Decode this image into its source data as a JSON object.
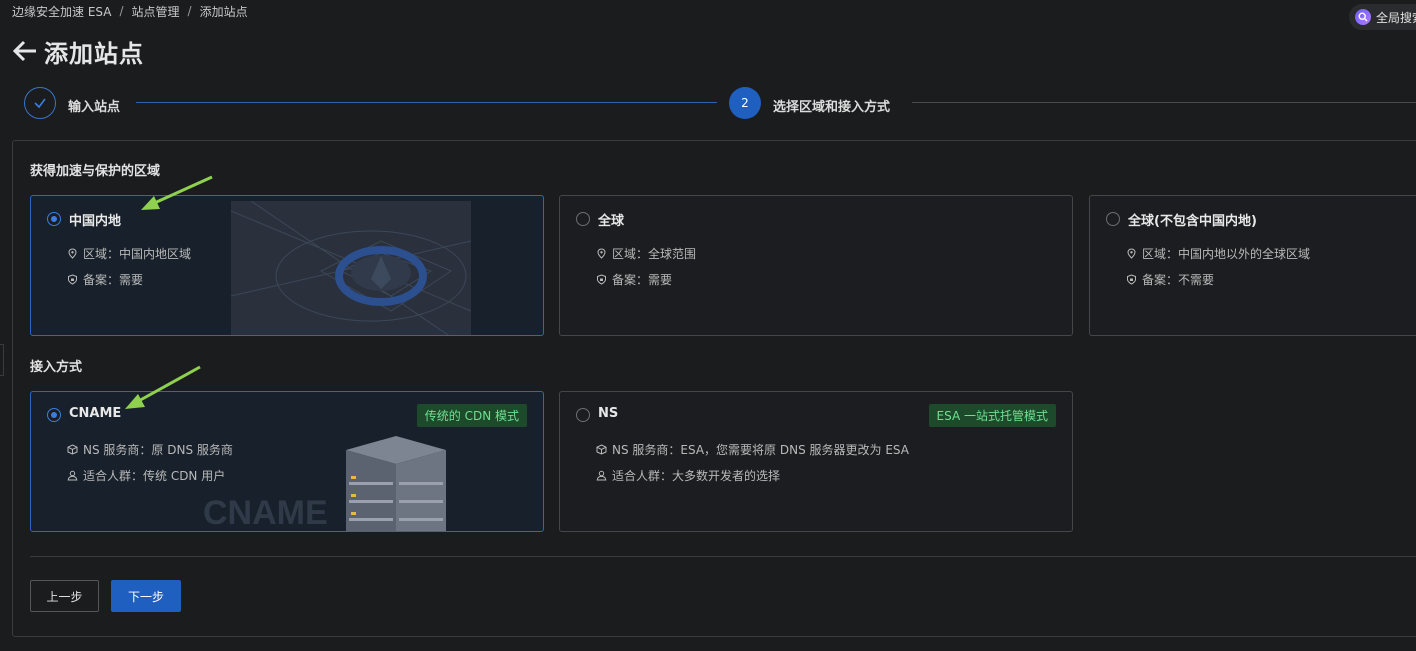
{
  "breadcrumb": [
    "边缘安全加速 ESA",
    "站点管理",
    "添加站点"
  ],
  "breadcrumb_sep": "/",
  "global_search": {
    "label": "全局搜索"
  },
  "header": {
    "title": "添加站点"
  },
  "steps": [
    {
      "label": "输入站点",
      "status": "done"
    },
    {
      "number": "2",
      "label": "选择区域和接入方式",
      "status": "active"
    }
  ],
  "region_section": {
    "title": "获得加速与保护的区域",
    "options": [
      {
        "title": "中国内地",
        "region_label": "区域：中国内地区域",
        "icp_label": "备案：需要",
        "selected": true
      },
      {
        "title": "全球",
        "region_label": "区域：全球范围",
        "icp_label": "备案：需要",
        "selected": false
      },
      {
        "title": "全球(不包含中国内地)",
        "region_label": "区域：中国内地以外的全球区域",
        "icp_label": "备案：不需要",
        "selected": false
      }
    ]
  },
  "access_section": {
    "title": "接入方式",
    "options": [
      {
        "title": "CNAME",
        "tag": "传统的 CDN 模式",
        "ns_label": "NS 服务商：原 DNS 服务商",
        "audience_label": "适合人群：传统 CDN 用户",
        "art_text": "CNAME",
        "selected": true
      },
      {
        "title": "NS",
        "tag": "ESA 一站式托管模式",
        "ns_label": "NS 服务商：ESA，您需要将原 DNS 服务器更改为 ESA",
        "audience_label": "适合人群：大多数开发者的选择",
        "selected": false
      }
    ]
  },
  "buttons": {
    "prev": "上一步",
    "next": "下一步"
  },
  "colors": {
    "accent": "#1f5fbf",
    "tag_bg": "#1e4a2c",
    "tag_text": "#6ee08f",
    "annotation": "#8fd14f"
  }
}
